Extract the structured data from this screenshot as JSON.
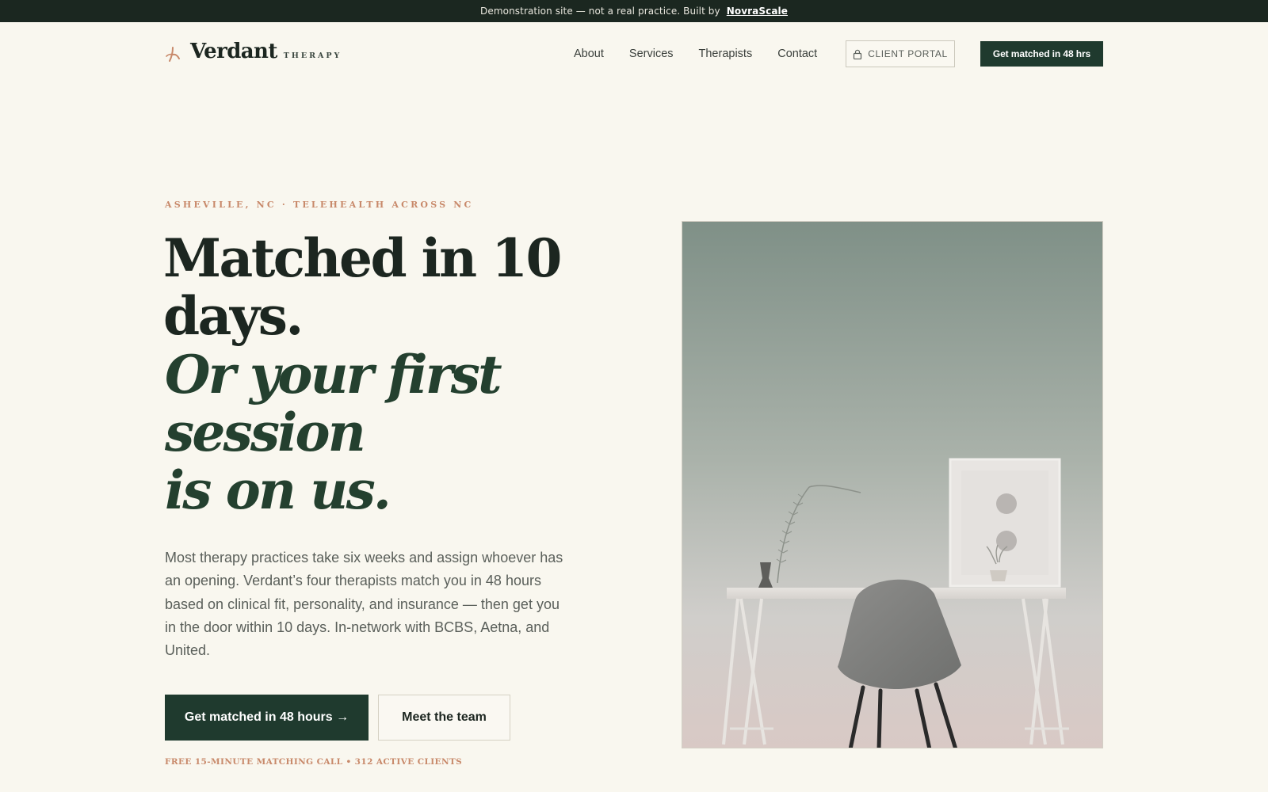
{
  "banner": {
    "text": "Demonstration site — not a real practice. Built by",
    "link_label": "NovraScale"
  },
  "header": {
    "logo_name": "Verdant",
    "logo_sub": "THERAPY",
    "nav": [
      "About",
      "Services",
      "Therapists",
      "Contact"
    ],
    "portal_label": "CLIENT PORTAL",
    "cta_label": "Get matched in 48 hrs"
  },
  "hero": {
    "eyebrow": "ASHEVILLE, NC · TELEHEALTH ACROSS NC",
    "headline_line1": "Matched in 10",
    "headline_line2": "days.",
    "headline_italic_line1": "Or your first",
    "headline_italic_line2": "session",
    "headline_italic_line3": "is on us.",
    "body": "Most therapy practices take six weeks and assign whoever has an opening. Verdant’s four therapists match you in 48 hours based on clinical fit, personality, and insurance — then get you in the door within 10 days. In-network with BCBS, Aetna, and United.",
    "primary_button": "Get matched in 48 hours →",
    "secondary_button": "Meet the team",
    "footnote": "FREE 15-MINUTE MATCHING CALL • 312 ACTIVE CLIENTS"
  },
  "colors": {
    "background": "#f9f7ef",
    "dark_green": "#1f3a2e",
    "accent_terracotta": "#c8896a",
    "banner": "#1b2720"
  }
}
